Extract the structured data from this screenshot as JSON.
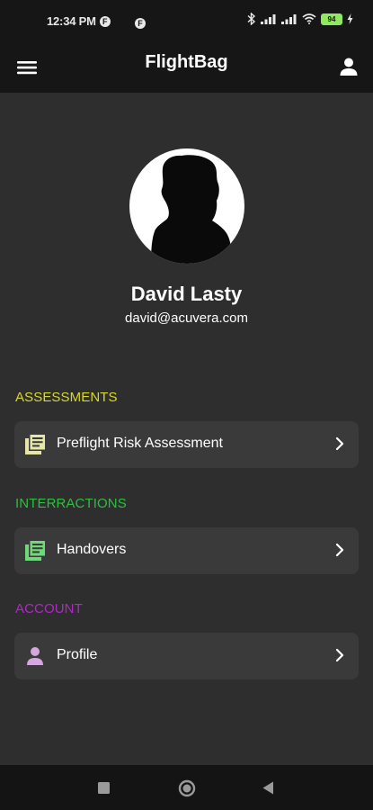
{
  "status_bar": {
    "time": "12:34 PM",
    "left_icon": "f-circle-icon",
    "mid_icon": "f-circle-icon",
    "battery": "94"
  },
  "app_bar": {
    "title": "FlightBag"
  },
  "profile": {
    "name": "David Lasty",
    "email": "david@acuvera.com"
  },
  "sections": [
    {
      "title": "ASSESSMENTS",
      "color": "#d8d82a",
      "item": {
        "label": "Preflight Risk Assessment",
        "icon": "document-list-icon",
        "icon_color": "#e6e6a6"
      }
    },
    {
      "title": "INTERRACTIONS",
      "color": "#2fbf3e",
      "item": {
        "label": "Handovers",
        "icon": "document-list-icon",
        "icon_color": "#6fd877"
      }
    },
    {
      "title": "ACCOUNT",
      "color": "#b326c9",
      "item": {
        "label": "Profile",
        "icon": "person-icon",
        "icon_color": "#d5a6e0"
      }
    }
  ],
  "colors": {
    "bars": "#161616",
    "background": "#2e2e2e",
    "card": "#3a3a3a"
  }
}
